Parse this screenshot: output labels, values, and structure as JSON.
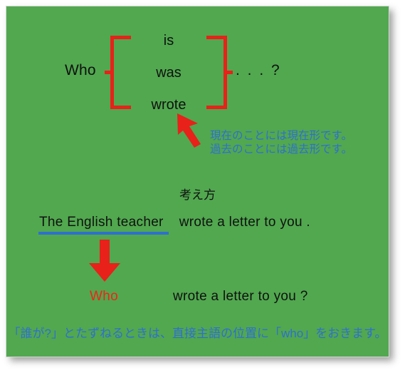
{
  "slide": {
    "background_color": "#51a84f",
    "border_color": "#d8d8d8",
    "accent_red": "#e8211a",
    "accent_blue": "#2f6fd0",
    "text_color": "#111111"
  },
  "pattern": {
    "lead_word": "Who",
    "verb_options": [
      "is",
      "was",
      "wrote"
    ],
    "tail": ". . . ?"
  },
  "tense_note": {
    "line1": "現在のことには現在形です。",
    "line2": "過去のことには過去形です。"
  },
  "method": {
    "heading": "考え方"
  },
  "example": {
    "source_subject": "The  English  teacher",
    "source_predicate": "wrote  a  letter  to  you .",
    "result_subject": "Who",
    "result_predicate": "wrote  a  letter  to  you ?"
  },
  "bottom_note": {
    "text": "「誰が?」とたずねるときは、直接主語の位置に「who」をおきます。"
  },
  "icons": {
    "diagonal_arrow": "arrow-up-left-icon",
    "down_arrow": "arrow-down-icon",
    "left_bracket": "bracket-left-icon",
    "right_bracket": "bracket-right-icon"
  }
}
